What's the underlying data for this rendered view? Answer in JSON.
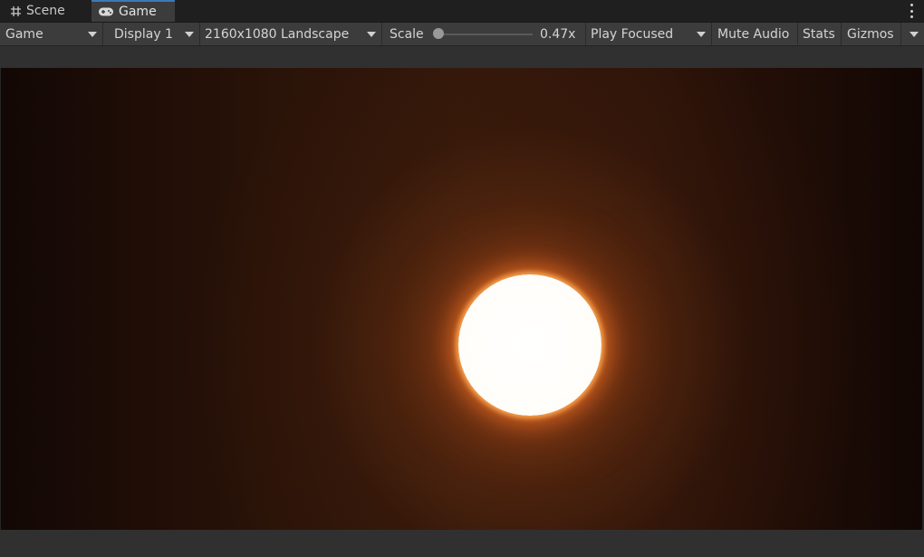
{
  "tabs": {
    "scene_label": "Scene",
    "game_label": "Game"
  },
  "toolbar": {
    "game_dropdown": "Game",
    "display_dropdown": "Display 1",
    "resolution_dropdown": "2160x1080 Landscape",
    "scale_label": "Scale",
    "scale_value": "0.47x",
    "play_mode_dropdown": "Play Focused",
    "mute_audio_label": "Mute Audio",
    "stats_label": "Stats",
    "gizmos_label": "Gizmos"
  },
  "icons": {
    "scene_tab": "grid-hash-icon",
    "game_tab": "gamepad-icon",
    "panel_menu": "kebab-menu-icon",
    "dropdown": "triangle-down-icon"
  },
  "colors": {
    "active_tab_accent": "#3a79bb",
    "sun_core": "#ffffff",
    "sun_glow": "#ff8a3c",
    "sky": "#32170a"
  }
}
